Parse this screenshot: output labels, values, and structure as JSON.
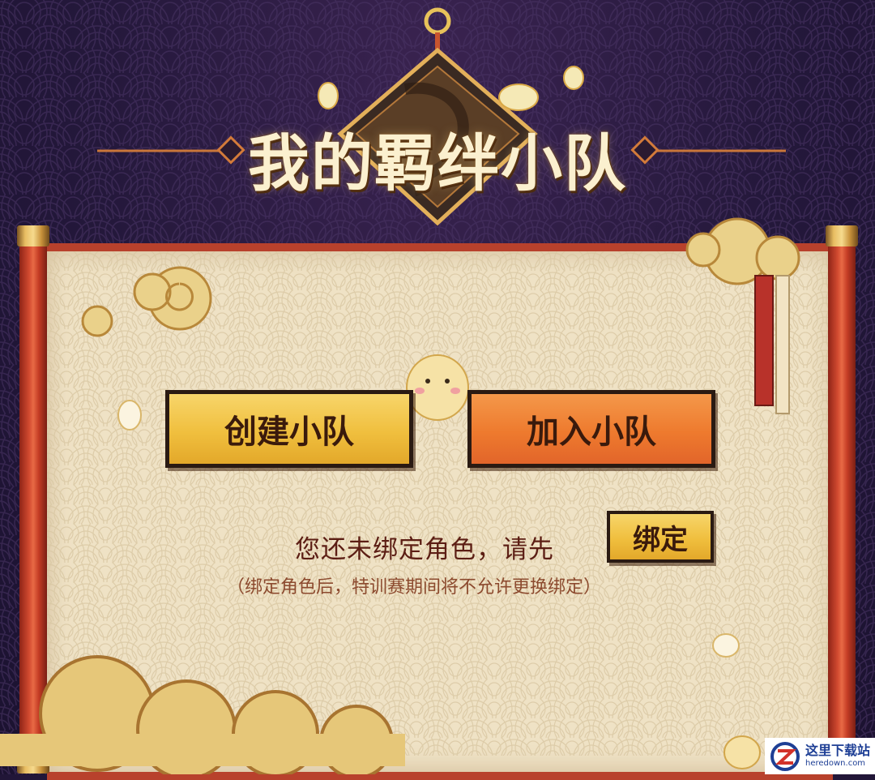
{
  "title": "我的羁绊小队",
  "buttons": {
    "create_label": "创建小队",
    "join_label": "加入小队",
    "bind_label": "绑定"
  },
  "notice": {
    "message": "您还未绑定角色，请先",
    "submessage": "（绑定角色后，特训赛期间将不允许更换绑定）"
  },
  "watermark": {
    "cn_text": "这里下载站",
    "en_text": "heredown.com"
  },
  "colors": {
    "background": "#24183b",
    "paper": "#efe2c5",
    "scroll_red": "#b8412c",
    "button_yellow": "#f0bf3e",
    "button_orange": "#ee7a2e",
    "title_text": "#fbf0cf",
    "notice_text": "#5c1e14"
  },
  "icons": [
    "cloud-icon",
    "mascot-icon",
    "diamond-ornament-icon",
    "ribbon-icon",
    "heredown-logo-icon"
  ]
}
